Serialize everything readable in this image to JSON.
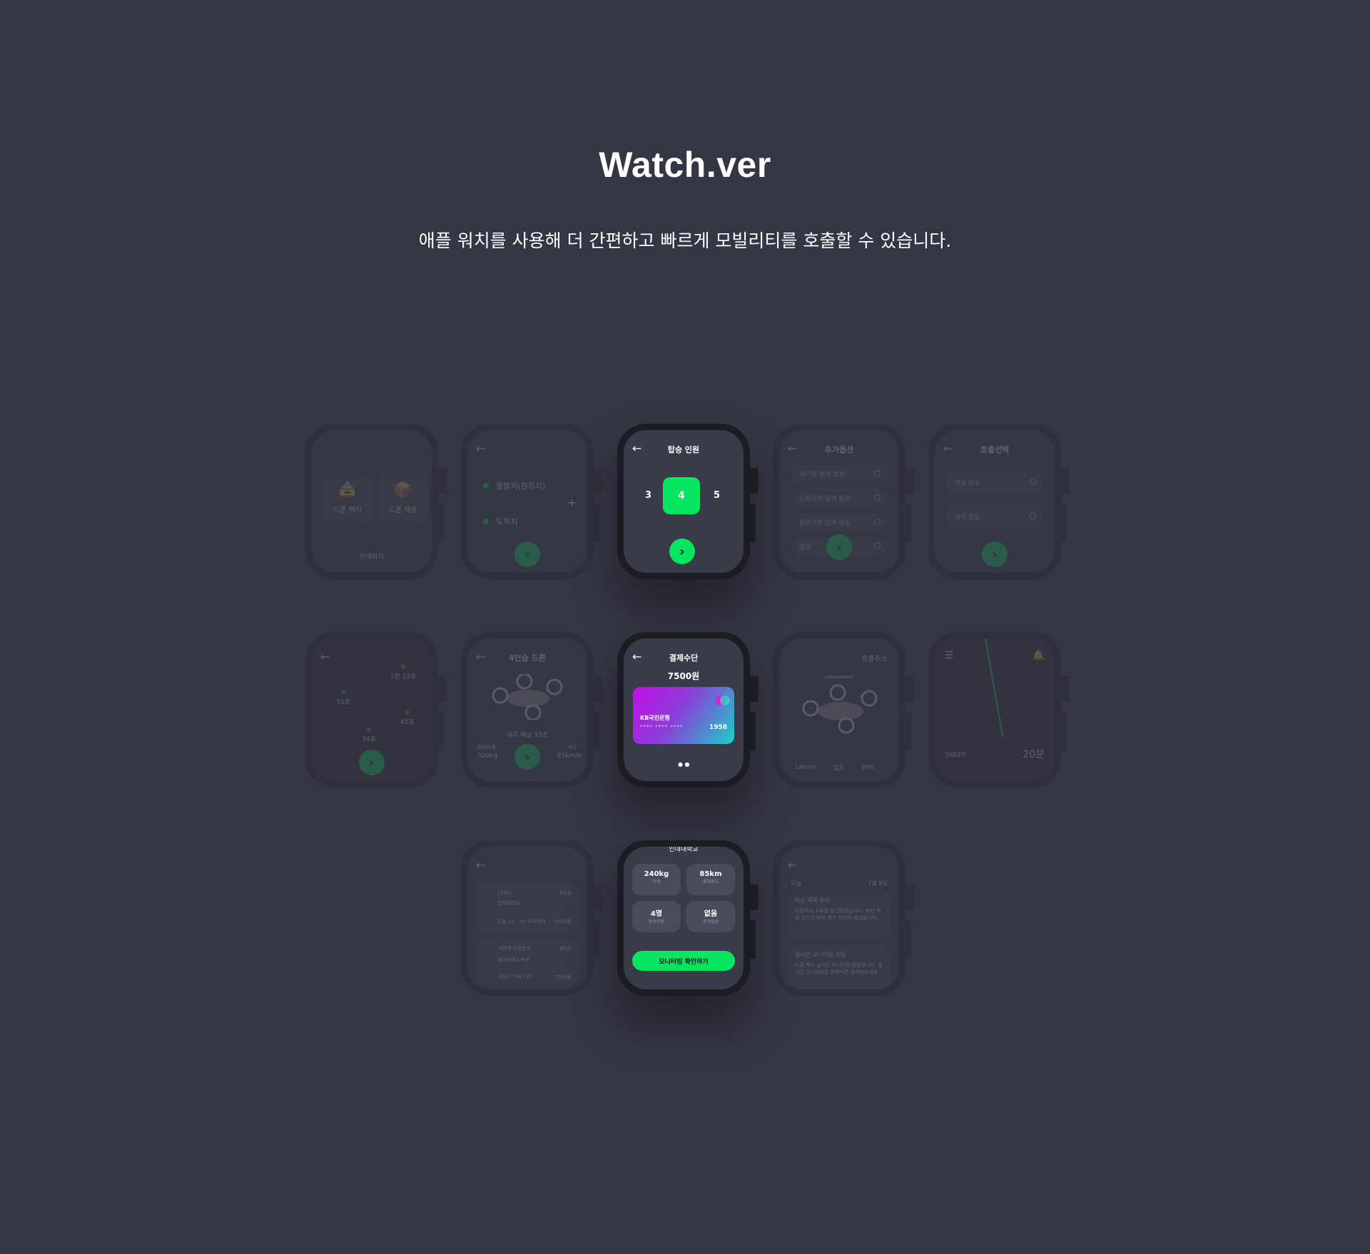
{
  "header": {
    "title": "Watch.ver",
    "subtitle": "애플 워치를 사용해 더 간편하고 빠르게 모빌리티를 호출할 수 있습니다."
  },
  "row1": {
    "home": {
      "taxi": "드론 택시",
      "delivery": "드론 배송",
      "footer": "안내하기"
    },
    "route": {
      "origin": "출발지(현위치)",
      "destination": "도착지"
    },
    "passengers": {
      "title": "탑승 인원",
      "prev": "3",
      "selected": "4",
      "next": "5"
    },
    "options": {
      "title": "추가옵션",
      "items": [
        "아기와 함께 탑승",
        "노약자와 함께 탑승",
        "휠체어와 함께 탑승",
        "없음"
      ]
    },
    "call": {
      "title": "호출선택",
      "items": [
        "바로 탑승",
        "예약 탑승"
      ]
    }
  },
  "row2": {
    "map": {
      "labels": [
        "55초",
        "1분 12초",
        "45초",
        "34초"
      ]
    },
    "drone": {
      "title": "4인승 드론",
      "wait": "대기 예상 55초",
      "left_label": "최대하중",
      "left_value": "300kg",
      "right_label": "속도",
      "right_value": "85km/h"
    },
    "payment": {
      "title": "결제수단",
      "amount": "7500원",
      "bank": "KB국민은행",
      "masked": "**** **** ****",
      "last4": "1958"
    },
    "cancel": {
      "title": "호출취소",
      "speed": "14km/h",
      "weather": "없음",
      "battery": "80%"
    },
    "tracking": {
      "place": "인데대역",
      "eta": "20분"
    }
  },
  "row3": {
    "history": {
      "from": "인데대",
      "from_time": "4인승",
      "to": "인하대학교",
      "note": "오늘 11 : 00 도착예정",
      "note_right": "5000원",
      "p1": "서면역 부산진정",
      "p1r": "4인승",
      "p2": "해운대해수욕장",
      "date": "2022 / 06 / 22",
      "date_right": "7500원"
    },
    "monitor": {
      "header": "인데대학교",
      "stats": [
        {
          "value": "240kg",
          "label": "무게"
        },
        {
          "value": "85km",
          "label": "최대속도"
        },
        {
          "value": "4명",
          "label": "탑승인원"
        },
        {
          "value": "없음",
          "label": "추가옵션"
        }
      ],
      "button": "모니터링 확인하기"
    },
    "alerts": {
      "today": "오늘",
      "date": "7월 9일",
      "a1_title": "비상 착륙 알림",
      "a1_body": "드론택시 오류를 발견하였습니다. 비상 착륙 모드가 켜져 대기 지연이 예상됩니다.",
      "a2_title": "실시간 모니터링 알림",
      "a2_body": "드론 택시 실시간 모니터링 알림입니다. 실시간 모니터링을 원하시면 클릭해주세요."
    }
  },
  "colors": {
    "background": "#353643",
    "accent": "#08e55f",
    "case": "#1c1d22",
    "screen": "#3a3b48"
  }
}
